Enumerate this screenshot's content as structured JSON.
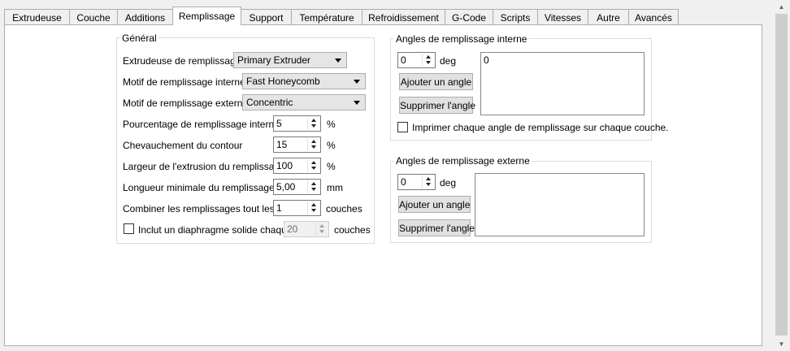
{
  "tabs": [
    {
      "label": "Extrudeuse"
    },
    {
      "label": "Couche"
    },
    {
      "label": "Additions"
    },
    {
      "label": "Remplissage"
    },
    {
      "label": "Support"
    },
    {
      "label": "Température"
    },
    {
      "label": "Refroidissement"
    },
    {
      "label": "G-Code"
    },
    {
      "label": "Scripts"
    },
    {
      "label": "Vitesses"
    },
    {
      "label": "Autre"
    },
    {
      "label": "Avancés"
    }
  ],
  "active_tab": "Remplissage",
  "general": {
    "title": "Général",
    "extruder_label": "Extrudeuse de remplissage",
    "extruder_value": "Primary Extruder",
    "interior_pattern_label": "Motif de remplissage interne",
    "interior_pattern_value": "Fast Honeycomb",
    "exterior_pattern_label": "Motif de remplissage externe",
    "exterior_pattern_value": "Concentric",
    "interior_pct_label": "Pourcentage de remplissage interne",
    "interior_pct_value": "5",
    "interior_pct_unit": "%",
    "outline_overlap_label": "Chevauchement du contour",
    "outline_overlap_value": "15",
    "outline_overlap_unit": "%",
    "extrusion_width_label": "Largeur de l'extrusion du remplissage",
    "extrusion_width_value": "100",
    "extrusion_width_unit": "%",
    "min_length_label": "Longueur minimale du remplissage",
    "min_length_value": "5,00",
    "min_length_unit": "mm",
    "combine_label": "Combiner les remplissages tout les",
    "combine_value": "1",
    "combine_unit": "couches",
    "diaphragm_label": "Inclut un diaphragme solide chaque",
    "diaphragm_value": "20",
    "diaphragm_unit": "couches",
    "diaphragm_checked": false
  },
  "interior_angles": {
    "title": "Angles de remplissage interne",
    "angle_value": "0",
    "angle_unit": "deg",
    "add_button": "Ajouter un angle",
    "remove_button": "Supprimer l'angle",
    "list_items": [
      "0"
    ],
    "print_every_label": "Imprimer chaque angle de remplissage sur chaque couche.",
    "print_every_checked": false
  },
  "exterior_angles": {
    "title": "Angles de remplissage externe",
    "angle_value": "0",
    "angle_unit": "deg",
    "add_button": "Ajouter un angle",
    "remove_button": "Supprimer l'angle",
    "list_items": []
  }
}
